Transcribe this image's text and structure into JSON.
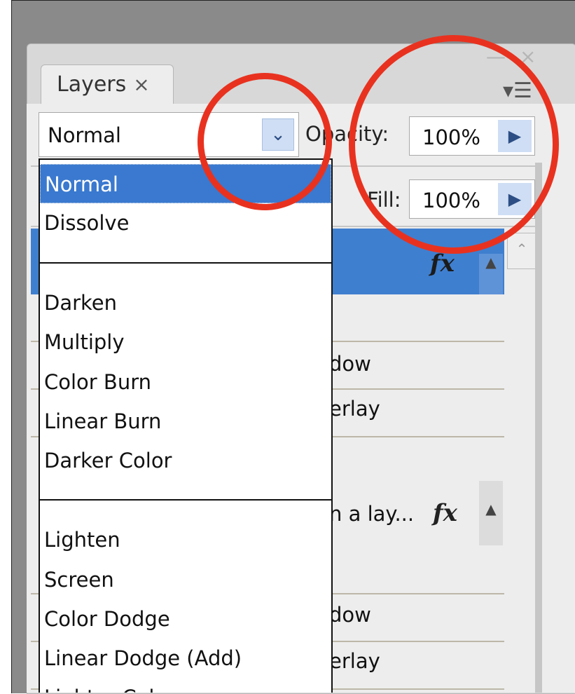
{
  "panel": {
    "tab_label": "Layers",
    "tab_close": "×",
    "minimize": "—",
    "close": "×",
    "menu_glyph": "▾☰"
  },
  "controls": {
    "blend_mode_value": "Normal",
    "opacity_label": "Opacity:",
    "opacity_value": "100%",
    "fill_label": "Fill:",
    "fill_value": "100%"
  },
  "blend_menu": {
    "groups": [
      [
        "Normal",
        "Dissolve"
      ],
      [
        "Darken",
        "Multiply",
        "Color Burn",
        "Linear Burn",
        "Darker Color"
      ],
      [
        "Lighten",
        "Screen",
        "Color Dodge",
        "Linear Dodge (Add)",
        "Lighter Color"
      ]
    ],
    "selected": "Normal"
  },
  "layers_partial": {
    "fx": "fx",
    "row_texts": [
      "dow",
      "erlay",
      "n a lay...",
      "dow",
      "erlay"
    ]
  },
  "colors": {
    "selection_blue": "#3a79cf",
    "annotation_red": "#e8321f",
    "background_gray": "#8a8a8a"
  }
}
